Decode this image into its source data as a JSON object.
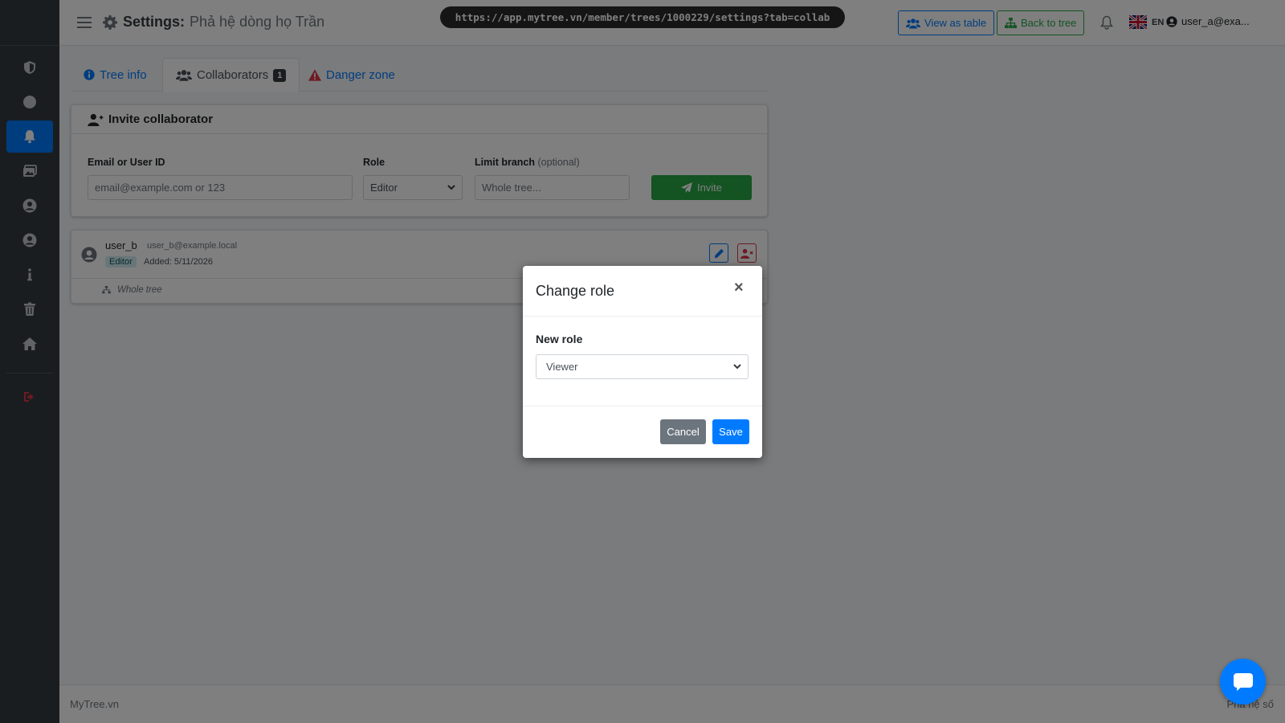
{
  "sidebar": {
    "items": [
      {
        "icon": "shield-icon"
      },
      {
        "icon": "circle-icon"
      },
      {
        "icon": "bell-icon",
        "active": true
      },
      {
        "icon": "images-icon"
      },
      {
        "icon": "user-circle-icon"
      },
      {
        "icon": "user-circle-icon"
      },
      {
        "icon": "info-icon"
      },
      {
        "icon": "trash-icon"
      },
      {
        "icon": "home-icon"
      },
      {
        "icon": "sign-out-icon"
      }
    ]
  },
  "header": {
    "title_prefix": "Settings:",
    "title": "Phả hệ dòng họ Trần",
    "url": "https://app.mytree.vn/member/trees/1000229/settings?tab=collab",
    "view_table_label": "View as table",
    "back_tree_label": "Back to tree",
    "lang": "EN",
    "user": "user_a@exa..."
  },
  "tabs": [
    {
      "label": "Tree info"
    },
    {
      "label": "Collaborators",
      "count": "1",
      "active": true
    },
    {
      "label": "Danger zone"
    }
  ],
  "invite": {
    "title": "Invite collaborator",
    "email_label": "Email or User ID",
    "email_placeholder": "email@example.com or 123",
    "role_label": "Role",
    "role_value": "Editor",
    "branch_label": "Limit branch",
    "branch_optional": "(optional)",
    "branch_placeholder": "Whole tree...",
    "invite_label": "Invite"
  },
  "collaborators": [
    {
      "name": "user_b",
      "email": "user_b@example.local",
      "role": "Editor",
      "added": "Added: 5/11/2026",
      "branch": "Whole tree"
    }
  ],
  "modal": {
    "title": "Change role",
    "close": "×",
    "label": "New role",
    "selected": "Viewer",
    "cancel_label": "Cancel",
    "save_label": "Save"
  },
  "footer": {
    "left": "MyTree.vn",
    "right": "Phả hệ số"
  },
  "colors": {
    "primary": "#007bff",
    "success": "#28a745",
    "danger": "#dc3545",
    "sidebar": "#343a40"
  }
}
